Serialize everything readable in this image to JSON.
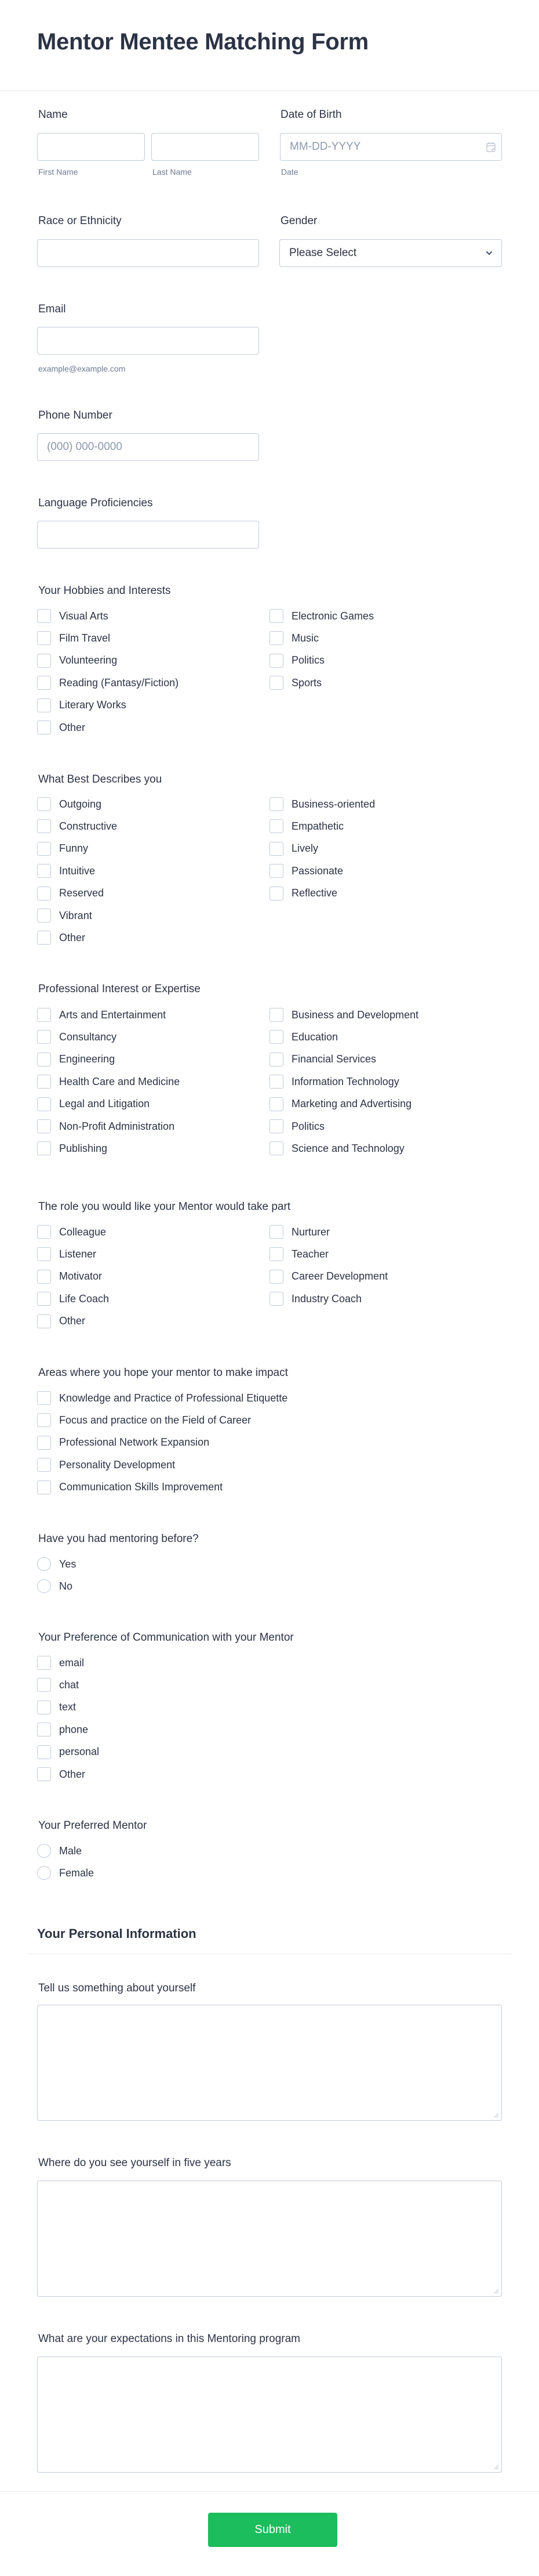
{
  "form": {
    "title": "Mentor Mentee Matching Form",
    "name": {
      "label": "Name",
      "first_sublabel": "First Name",
      "last_sublabel": "Last Name",
      "first_value": "",
      "last_value": ""
    },
    "dob": {
      "label": "Date of Birth",
      "placeholder": "MM-DD-YYYY",
      "sublabel": "Date",
      "icon": "calendar-icon"
    },
    "race": {
      "label": "Race or Ethnicity",
      "value": ""
    },
    "gender": {
      "label": "Gender",
      "selected": "Please Select",
      "icon": "chevron-down-icon"
    },
    "email": {
      "label": "Email",
      "value": "",
      "hint": "example@example.com"
    },
    "phone": {
      "label": "Phone Number",
      "placeholder": "(000) 000-0000"
    },
    "language": {
      "label": "Language Proficiencies",
      "value": ""
    },
    "hobbies": {
      "label": "Your Hobbies and Interests",
      "left": [
        "Visual Arts",
        "Film Travel",
        "Volunteering",
        "Reading (Fantasy/Fiction)",
        "Literary Works",
        "Other"
      ],
      "right": [
        "Electronic Games",
        "Music",
        "Politics",
        "Sports"
      ]
    },
    "describes": {
      "label": "What Best Describes you",
      "left": [
        "Outgoing",
        "Constructive",
        "Funny",
        "Intuitive",
        "Reserved",
        "Vibrant",
        "Other"
      ],
      "right": [
        "Business-oriented",
        "Empathetic",
        "Lively",
        "Passionate",
        "Reflective"
      ]
    },
    "professional": {
      "label": "Professional Interest or Expertise",
      "left": [
        "Arts and Entertainment",
        "Consultancy",
        "Engineering",
        "Health Care and Medicine",
        "Legal and Litigation",
        "Non-Profit Administration",
        "Publishing"
      ],
      "right": [
        "Business and Development",
        "Education",
        "Financial Services",
        "Information Technology",
        "Marketing and Advertising",
        "Politics",
        "Science and Technology"
      ]
    },
    "role": {
      "label": "The role you would like your Mentor would take part",
      "left": [
        "Colleague",
        "Listener",
        "Motivator",
        "Life Coach",
        "Other"
      ],
      "right": [
        "Nurturer",
        "Teacher",
        "Career Development",
        "Industry Coach"
      ]
    },
    "impact": {
      "label": "Areas where you hope your mentor to make impact",
      "options": [
        "Knowledge and Practice of Professional Etiquette",
        "Focus and practice on the Field of Career",
        "Professional Network Expansion",
        "Personality Development",
        "Communication Skills Improvement"
      ]
    },
    "mentoring_before": {
      "label": "Have you had mentoring before?",
      "options": [
        "Yes",
        "No"
      ]
    },
    "communication": {
      "label": "Your Preference of Communication with your Mentor",
      "options": [
        "email",
        "chat",
        "text",
        "phone",
        "personal",
        "Other"
      ]
    },
    "preferred_mentor": {
      "label": "Your Preferred Mentor",
      "options": [
        "Male",
        "Female"
      ]
    },
    "personal_section": {
      "title": "Your Personal Information"
    },
    "about": {
      "label": "Tell us something about yourself",
      "value": ""
    },
    "five_years": {
      "label": "Where do you see yourself in five years",
      "value": ""
    },
    "expectations": {
      "label": "What are your expectations in this Mentoring program",
      "value": ""
    },
    "submit_label": "Submit",
    "colors": {
      "accent": "#1bbd5c",
      "text": "#2c3345",
      "border": "#c3cad8",
      "muted": "#6f7a92"
    }
  }
}
